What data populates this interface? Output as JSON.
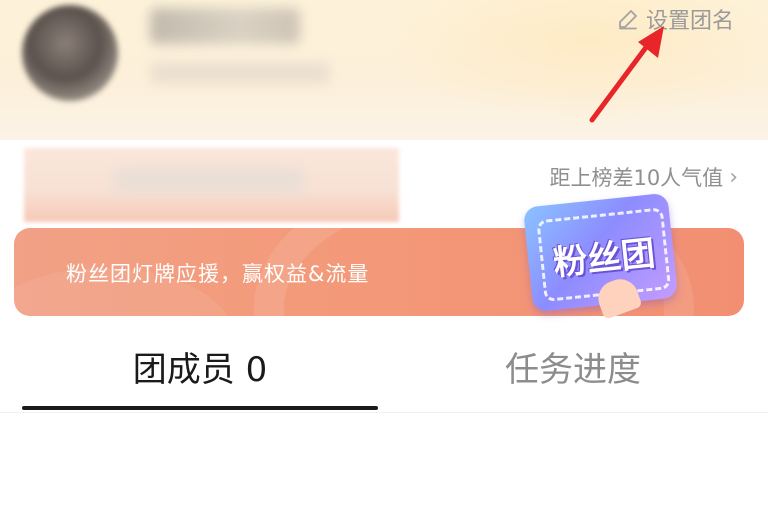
{
  "header": {
    "set_group_name": "设置团名",
    "icons": {
      "edit": "pencil-icon",
      "arrow": "annotation-arrow"
    },
    "colors": {
      "arrow": "#e8262a",
      "background": "#fdf2d9"
    }
  },
  "info": {
    "rank_gap": "距上榜差10人气值",
    "chevron": "›"
  },
  "banner": {
    "text": "粉丝团灯牌应援，赢权益&流量",
    "badge_text": "粉丝团",
    "colors": {
      "background": "#f39a7a",
      "badge": "#8d8cff"
    }
  },
  "tabs": [
    {
      "label": "团成员 0",
      "active": true
    },
    {
      "label": "任务进度",
      "active": false
    }
  ]
}
